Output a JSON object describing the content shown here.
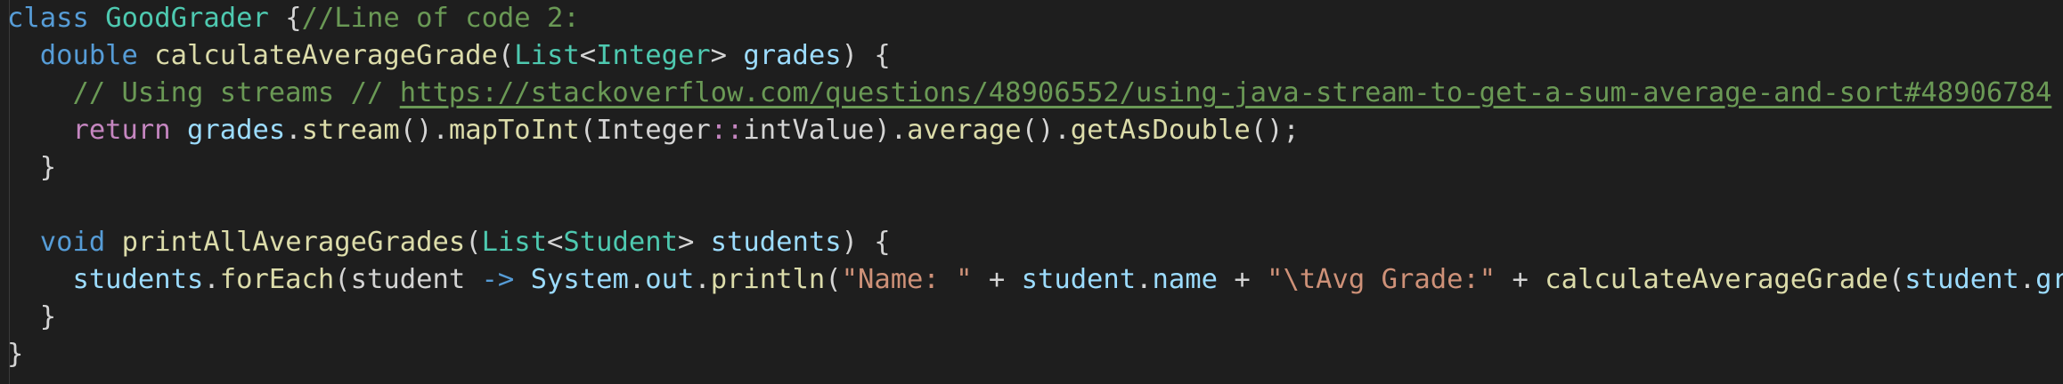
{
  "code": {
    "line1": {
      "kw_class": "class",
      "class_name": "GoodGrader",
      "brace": " {",
      "comment": "//Line of code 2:"
    },
    "line2": {
      "indent": "  ",
      "return_type": "double",
      "method_name": "calculateAverageGrade",
      "open_paren": "(",
      "param_type": "List",
      "lt": "<",
      "generic_type": "Integer",
      "gt": "> ",
      "param_name": "grades",
      "tail": ") {"
    },
    "line3": {
      "indent": "    ",
      "comment": "// Using streams // ",
      "url": "https://stackoverflow.com/questions/48906552/using-java-stream-to-get-a-sum-average-and-sort#48906784"
    },
    "line4": {
      "indent": "    ",
      "kw_return": "return",
      "sp": " ",
      "var_grades": "grades",
      "dot1": ".",
      "fn_stream": "stream",
      "p1": "().",
      "fn_maptoint": "mapToInt",
      "p2": "(",
      "type_integer": "Integer",
      "op_ref": "::",
      "fn_intvalue": "intValue",
      "p3": ").",
      "fn_average": "average",
      "p4": "().",
      "fn_getasdouble": "getAsDouble",
      "p5": "();"
    },
    "line5": {
      "indent": "  ",
      "brace": "}"
    },
    "line7": {
      "indent": "  ",
      "return_type": "void",
      "method_name": "printAllAverageGrades",
      "open_paren": "(",
      "param_type": "List",
      "lt": "<",
      "generic_type": "Student",
      "gt": "> ",
      "param_name": "students",
      "tail": ") {"
    },
    "line8": {
      "indent": "    ",
      "var_students": "students",
      "dot1": ".",
      "fn_foreach": "forEach",
      "p1": "(student ",
      "arrow": "->",
      "sp": " ",
      "type_system": "System",
      "dot2": ".",
      "var_out": "out",
      "dot3": ".",
      "fn_println": "println",
      "p2": "(",
      "str_name": "\"Name: \"",
      "plus1": " + ",
      "var_student": "student",
      "dot4": ".",
      "var_name": "name",
      "plus2": " + ",
      "str_avg": "\"\\tAvg Grade:\"",
      "plus3": " + ",
      "fn_calc": "calculateAverageGrade",
      "p3": "(",
      "var_student2": "student",
      "dot5": ".",
      "var_grades": "grades",
      "p4": "));"
    },
    "line9": {
      "indent": "  ",
      "brace": "}"
    },
    "line10": {
      "brace": "}"
    }
  }
}
